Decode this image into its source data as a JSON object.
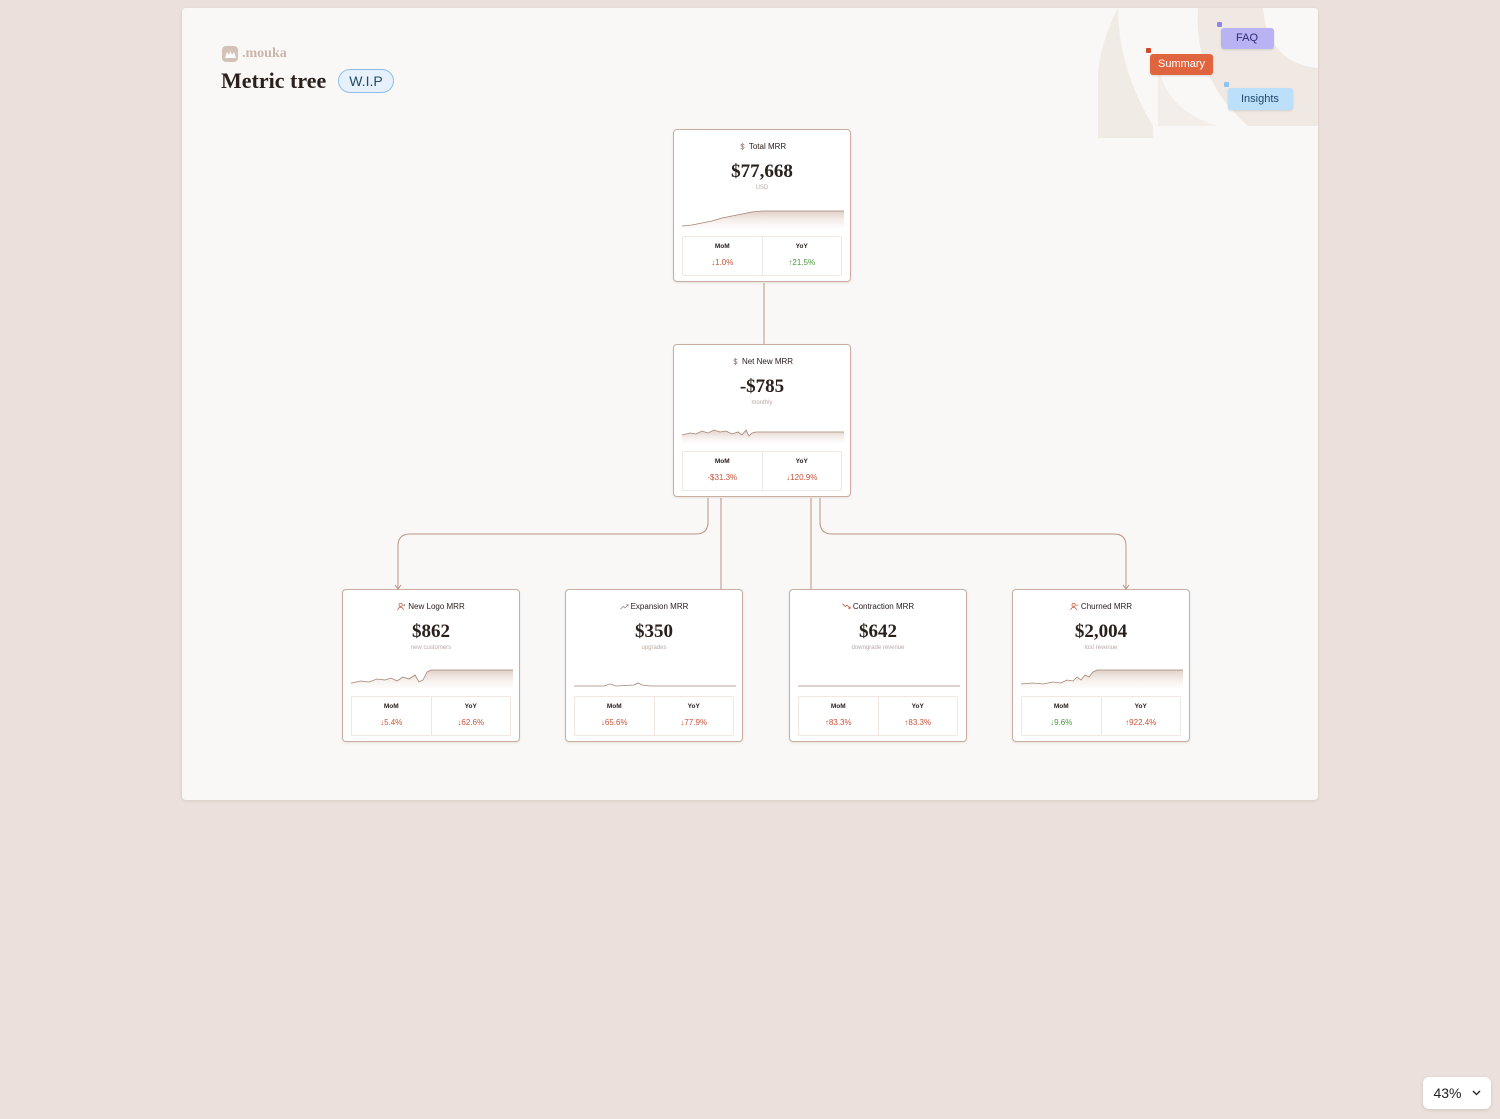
{
  "brand": {
    "name": ".mouka"
  },
  "page": {
    "title": "Metric tree",
    "badge": "W.I.P"
  },
  "chips": {
    "faq": "FAQ",
    "summary": "Summary",
    "insights": "Insights"
  },
  "cards": {
    "total_mrr": {
      "label": "Total MRR",
      "value": "$77,668",
      "sub": "USD",
      "mom_label": "MoM",
      "mom": "↓1.0%",
      "yoy_label": "YoY",
      "yoy": "↑21.5%"
    },
    "net_new_mrr": {
      "label": "Net New MRR",
      "value": "-$785",
      "sub": "monthly",
      "mom_label": "MoM",
      "mom": "-$31.3%",
      "yoy_label": "YoY",
      "yoy": "↓120.9%"
    },
    "new_logo_mrr": {
      "label": "New Logo MRR",
      "value": "$862",
      "sub": "new customers",
      "mom_label": "MoM",
      "mom": "↓5.4%",
      "yoy_label": "YoY",
      "yoy": "↓62.6%"
    },
    "expansion_mrr": {
      "label": "Expansion MRR",
      "value": "$350",
      "sub": "upgrades",
      "mom_label": "MoM",
      "mom": "↓65.6%",
      "yoy_label": "YoY",
      "yoy": "↓77.9%"
    },
    "contraction_mrr": {
      "label": "Contraction MRR",
      "value": "$642",
      "sub": "downgrade revenue",
      "mom_label": "MoM",
      "mom": "↑83.3%",
      "yoy_label": "YoY",
      "yoy": "↑83.3%"
    },
    "churned_mrr": {
      "label": "Churned MRR",
      "value": "$2,004",
      "sub": "lost revenue",
      "mom_label": "MoM",
      "mom": "↓9.6%",
      "yoy_label": "YoY",
      "yoy": "↑922.4%"
    }
  },
  "zoom": {
    "level": "43%"
  },
  "colors": {
    "accent": "#e0643e",
    "negative": "#c55339",
    "positive": "#4a9a3f",
    "line": "#b89484"
  }
}
